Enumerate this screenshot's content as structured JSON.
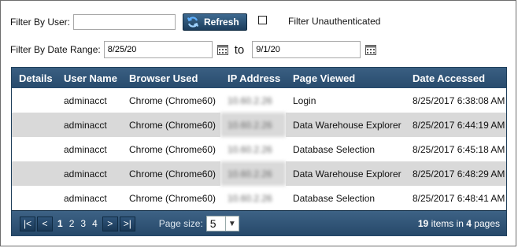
{
  "filters": {
    "user_label": "Filter By User:",
    "user_value": "",
    "refresh_label": "Refresh",
    "unauth_label": "Filter Unauthenticated",
    "date_label": "Filter By Date Range:",
    "date_from": "8/25/20",
    "date_to": "9/1/20",
    "to_label": "to"
  },
  "table": {
    "columns": [
      "Details",
      "User Name",
      "Browser Used",
      "IP Address",
      "Page Viewed",
      "Date Accessed"
    ],
    "rows": [
      {
        "details": "",
        "user": "adminacct",
        "browser": "Chrome (Chrome60)",
        "ip": "10.60.2.26",
        "page": "Login",
        "date": "8/25/2017 6:38:08 AM"
      },
      {
        "details": "",
        "user": "adminacct",
        "browser": "Chrome (Chrome60)",
        "ip": "10.60.2.26",
        "page": "Data Warehouse Explorer",
        "date": "8/25/2017 6:44:19 AM"
      },
      {
        "details": "",
        "user": "adminacct",
        "browser": "Chrome (Chrome60)",
        "ip": "10.60.2.26",
        "page": "Database Selection",
        "date": "8/25/2017 6:45:18 AM"
      },
      {
        "details": "",
        "user": "adminacct",
        "browser": "Chrome (Chrome60)",
        "ip": "10.60.2.26",
        "page": "Data Warehouse Explorer",
        "date": "8/25/2017 6:48:29 AM"
      },
      {
        "details": "",
        "user": "adminacct",
        "browser": "Chrome (Chrome60)",
        "ip": "10.60.2.26",
        "page": "Database Selection",
        "date": "8/25/2017 6:48:41 AM"
      }
    ]
  },
  "pager": {
    "first": "|<",
    "prev": "<",
    "pages": [
      "1",
      "2",
      "3",
      "4"
    ],
    "current_page": "1",
    "next": ">",
    "last": ">|",
    "page_size_label": "Page size:",
    "page_size": "5",
    "item_count": "19",
    "items_in_text": "items in",
    "page_count": "4",
    "pages_text": "pages"
  },
  "colors": {
    "header": "#2f5377",
    "alt_row": "#d9d9d9"
  }
}
